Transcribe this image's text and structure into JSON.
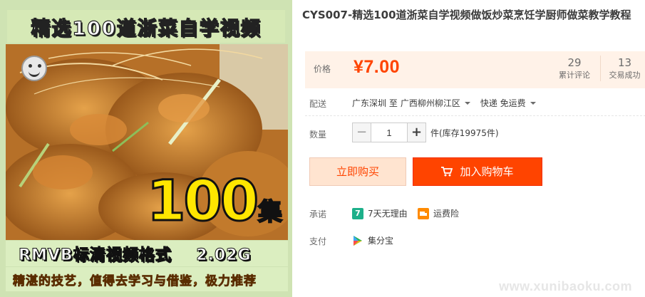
{
  "product_image": {
    "banner_title": "精选100道浙菜自学视频",
    "episodes_number": "100",
    "episodes_unit": "集",
    "format_line": "RMVB标清视频格式    2.02G",
    "slogan": "精湛的技艺，值得去学习与借鉴，极力推荐"
  },
  "product": {
    "title": "CYS007-精选100道浙菜自学视频做饭炒菜烹饪学厨师做菜教学教程"
  },
  "price": {
    "label": "价格",
    "value": "¥7.00",
    "reviews_count": "29",
    "reviews_label": "累计评论",
    "sales_count": "13",
    "sales_label": "交易成功"
  },
  "shipping": {
    "label": "配送",
    "from": "广东深圳 至",
    "to": "广西柳州柳江区",
    "method": "快递 免运费"
  },
  "quantity": {
    "label": "数量",
    "minus": "−",
    "value": "1",
    "plus": "+",
    "stock_text": "件(库存19975件)"
  },
  "actions": {
    "buy_now": "立即购买",
    "add_to_cart": "加入购物车"
  },
  "promise": {
    "label": "承诺",
    "items": [
      {
        "icon": "seven-day-return-icon",
        "icon_glyph": "7",
        "text": "7天无理由"
      },
      {
        "icon": "shipping-insurance-icon",
        "icon_glyph": "",
        "text": "运费险"
      }
    ]
  },
  "payment": {
    "label": "支付",
    "method": "集分宝"
  },
  "watermark": "www.xunibaoku.com",
  "colors": {
    "accent": "#ff4400",
    "price_bg": "#fff2e8",
    "buy_now_bg": "#ffe4d0",
    "seven_day_green": "#1db08a",
    "insurance_orange": "#ff8a00"
  }
}
